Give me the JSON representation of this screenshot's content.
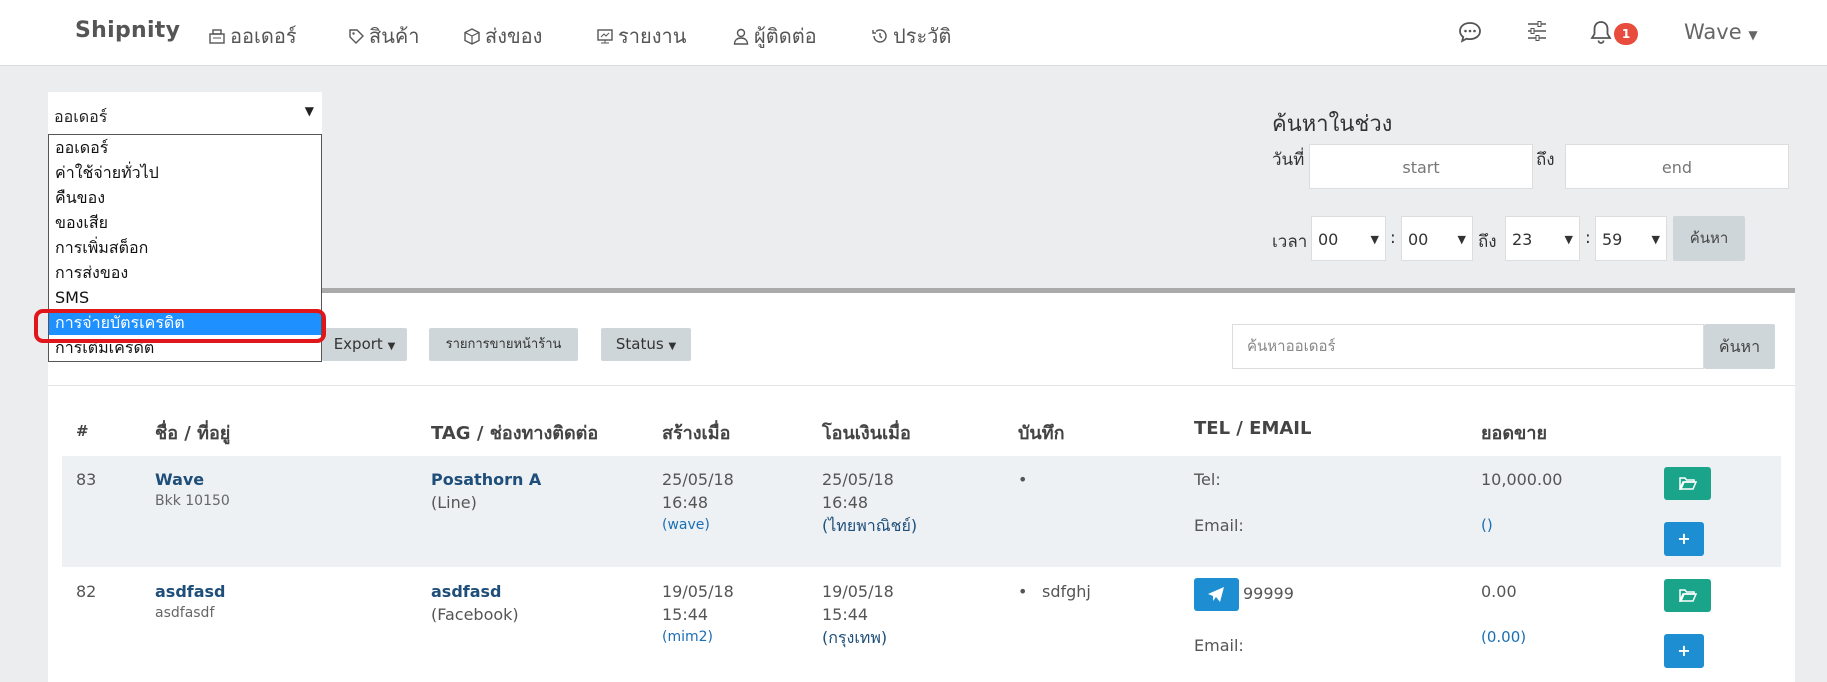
{
  "navbar": {
    "brand": "Shipnity",
    "items": [
      {
        "label": "ออเดอร์",
        "icon": "cash-register-icon"
      },
      {
        "label": "สินค้า",
        "icon": "tag-icon"
      },
      {
        "label": "ส่งของ",
        "icon": "box-icon"
      },
      {
        "label": "รายงาน",
        "icon": "monitor-chart-icon"
      },
      {
        "label": "ผู้ติดต่อ",
        "icon": "user-icon"
      },
      {
        "label": "ประวัติ",
        "icon": "history-icon"
      }
    ],
    "notification_count": "1",
    "user": "Wave"
  },
  "filter": {
    "selected": "ออเดอร์",
    "options": [
      "ออเดอร์",
      "ค่าใช้จ่ายทั่วไป",
      "คืนของ",
      "ของเสีย",
      "การเพิ่มสต็อก",
      "การส่งของ",
      "SMS",
      "การจ่ายบัตรเครดิต",
      "การเติมเครดิต"
    ],
    "highlighted": "การจ่ายบัตรเครดิต"
  },
  "range": {
    "title": "ค้นหาในช่วง",
    "date_label": "วันที่",
    "to_label": "ถึง",
    "start_placeholder": "start",
    "end_placeholder": "end",
    "time_label": "เวลา",
    "from_hour": "00",
    "from_minute": "00",
    "to_hour": "23",
    "to_minute": "59",
    "colon": ":",
    "search_button": "ค้นหา"
  },
  "toolbar": {
    "export": "Export",
    "storefront": "รายการขายหน้าร้าน",
    "status": "Status",
    "search_placeholder": "ค้นหาออเดอร์",
    "search_button": "ค้นหา"
  },
  "table": {
    "headers": [
      "#",
      "ชื่อ / ที่อยู่",
      "TAG / ช่องทางติดต่อ",
      "สร้างเมื่อ",
      "โอนเงินเมื่อ",
      "บันทึก",
      "TEL / EMAIL",
      "ยอดขาย"
    ],
    "rows": [
      {
        "id": "83",
        "name": "Wave",
        "address": "Bkk 10150",
        "tag": "Posathorn A",
        "channel": "(Line)",
        "created_date": "25/05/18",
        "created_time": "16:48",
        "created_by": "(wave)",
        "paid_date": "25/05/18",
        "paid_time": "16:48",
        "paid_bank": "(ไทยพาณิชย์)",
        "note": "",
        "tel_label": "Tel:",
        "tel": "",
        "email_label": "Email:",
        "amount": "10,000.00",
        "amount_sub": "()"
      },
      {
        "id": "82",
        "name": "asdfasd",
        "address": "asdfasdf",
        "tag": "asdfasd",
        "channel": "(Facebook)",
        "created_date": "19/05/18",
        "created_time": "15:44",
        "created_by": "(mim2)",
        "paid_date": "19/05/18",
        "paid_time": "15:44",
        "paid_bank": "(กรุงเทพ)",
        "note": "sdfghj",
        "tel_label": "",
        "tel": "99999",
        "email_label": "Email:",
        "amount": "0.00",
        "amount_sub": "(0.00)"
      }
    ],
    "add_label": "+",
    "bullet": "•"
  },
  "colors": {
    "accent_teal": "#1aa58b",
    "accent_blue": "#1c8ed1",
    "selected_option": "#1e90ff",
    "highlight_ring": "#e0161b"
  }
}
